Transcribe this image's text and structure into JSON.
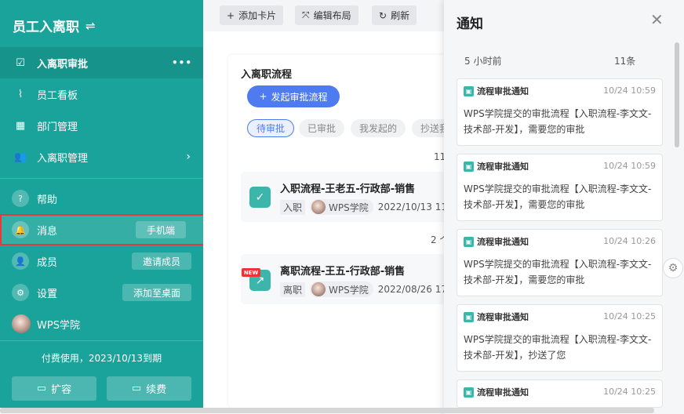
{
  "sidebar": {
    "title": "员工入离职",
    "switch_icon": "⇌",
    "items": [
      {
        "label": "入离职审批",
        "icon": "☑",
        "more": "•••"
      },
      {
        "label": "员工看板",
        "icon": "⌇"
      },
      {
        "label": "部门管理",
        "icon": "▦"
      },
      {
        "label": "入离职管理",
        "icon": "👥",
        "chevron": "›"
      }
    ],
    "help": {
      "label": "帮助",
      "icon": "?"
    },
    "messages": {
      "label": "消息",
      "icon": "🔔",
      "button": "手机端"
    },
    "members": {
      "label": "成员",
      "icon": "👤",
      "button": "邀请成员"
    },
    "settings": {
      "label": "设置",
      "icon": "⚙",
      "button": "添加至桌面"
    },
    "account": {
      "label": "WPS学院"
    },
    "footer_text": "付费使用，2023/10/13到期",
    "expand_label": "扩容",
    "renew_label": "续费"
  },
  "toolbar": {
    "add_card": "添加卡片",
    "edit_layout": "编辑布局",
    "refresh": "刷新"
  },
  "workflow": {
    "title": "入离职流程",
    "start_button": "发起审批流程",
    "tabs": [
      "待审批",
      "已审批",
      "我发起的",
      "抄送我"
    ],
    "counts": [
      "11",
      "2 个"
    ],
    "flows": [
      {
        "title": "入职流程-王老五-行政部-销售",
        "tag": "入职",
        "org": "WPS学院",
        "date": "2022/10/13 11"
      },
      {
        "title": "离职流程-王五-行政部-销售",
        "tag": "离职",
        "org": "WPS学院",
        "date": "2022/08/26 17",
        "badge": "NEW"
      }
    ]
  },
  "notifications": {
    "title": "通知",
    "group_time": "5 小时前",
    "group_count": "11条",
    "items": [
      {
        "type": "流程审批通知",
        "time": "10/24 10:59",
        "body": "WPS学院提交的审批流程【入职流程-李文文-技术部-开发】，需要您的审批"
      },
      {
        "type": "流程审批通知",
        "time": "10/24 10:59",
        "body": "WPS学院提交的审批流程【入职流程-李文文-技术部-开发】，需要您的审批"
      },
      {
        "type": "流程审批通知",
        "time": "10/24 10:26",
        "body": "WPS学院提交的审批流程【入职流程-李文文-技术部-开发】，需要您的审批"
      },
      {
        "type": "流程审批通知",
        "time": "10/24 10:25",
        "body": "WPS学院提交的审批流程【入职流程-李文文-技术部-开发】，抄送了您"
      },
      {
        "type": "流程审批通知",
        "time": "10/24 10:25",
        "body": ""
      }
    ]
  },
  "colors": {
    "sidebar": "#1aa39a",
    "primary": "#4e7cf0",
    "highlight": "#e23b3b"
  }
}
